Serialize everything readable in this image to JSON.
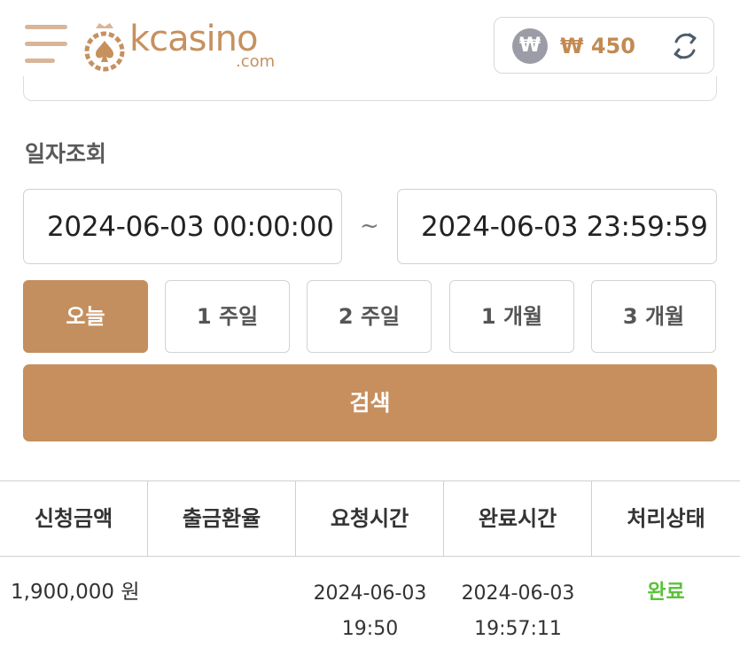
{
  "header": {
    "logo_text": "kcasino",
    "logo_sub": ".com",
    "currency_symbol": "₩",
    "balance": "₩ 450"
  },
  "search": {
    "label": "일자조회",
    "date_from": "2024-06-03 00:00:00",
    "separator": "~",
    "date_to": "2024-06-03 23:59:59",
    "periods": [
      "오늘",
      "1 주일",
      "2 주일",
      "1 개월",
      "3 개월"
    ],
    "active_period": "오늘",
    "search_label": "검색"
  },
  "table": {
    "columns": [
      "신청금액",
      "출금환율",
      "요청시간",
      "완료시간",
      "처리상태"
    ],
    "rows": [
      {
        "amount": "1,900,000 원",
        "rate": "",
        "request_date": "2024-06-03",
        "request_time": "19:50",
        "complete_date": "2024-06-03",
        "complete_time": "19:57:11",
        "status": "완료"
      }
    ]
  },
  "colors": {
    "accent": "#c68f5d",
    "status_done": "#5cc23c",
    "won_badge": "#9c9ca6"
  },
  "icons": [
    "menu-icon",
    "spade-logo-icon",
    "won-icon",
    "refresh-icon"
  ]
}
